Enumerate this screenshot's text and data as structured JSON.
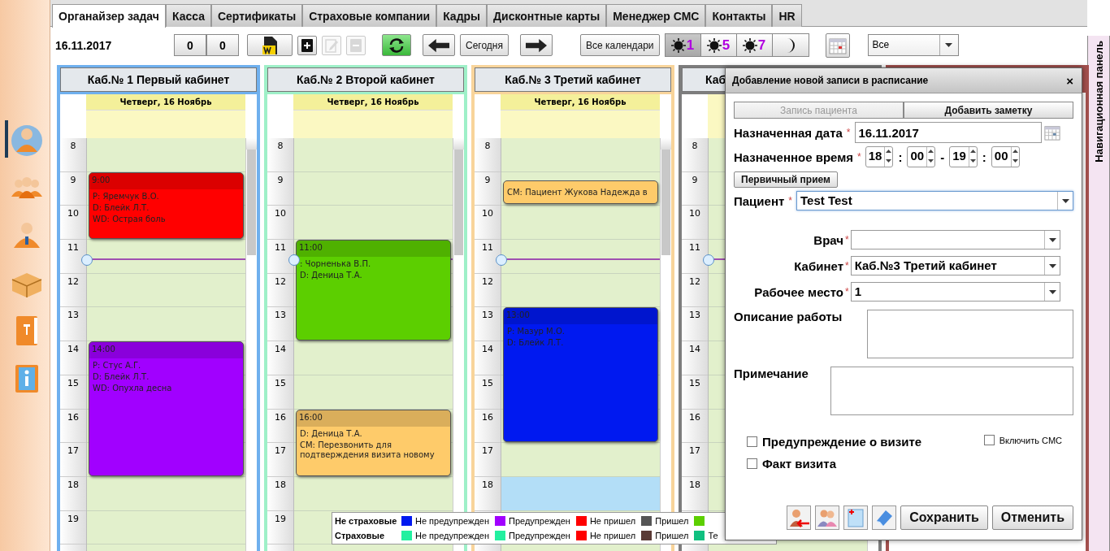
{
  "sidebar": {
    "items": [
      {
        "selected": true
      },
      {
        "selected": false
      },
      {
        "selected": false
      },
      {
        "selected": false
      },
      {
        "selected": false
      },
      {
        "selected": false
      }
    ]
  },
  "tabs": [
    {
      "label": "Органайзер задач",
      "selected": true
    },
    {
      "label": "Касса",
      "selected": false
    },
    {
      "label": "Сертификаты",
      "selected": false
    },
    {
      "label": "Страховые компании",
      "selected": false
    },
    {
      "label": "Кадры",
      "selected": false
    },
    {
      "label": "Дисконтные карты",
      "selected": false
    },
    {
      "label": "Менеджер СМС",
      "selected": false
    },
    {
      "label": "Контакты",
      "selected": false
    },
    {
      "label": "HR",
      "selected": false
    }
  ],
  "toolbar": {
    "date": "16.11.2017",
    "counters": [
      "0",
      "0"
    ],
    "actions": [
      {
        "kind": "word",
        "disabled": false
      },
      {
        "kind": "add",
        "disabled": false
      },
      {
        "kind": "edit",
        "disabled": true
      },
      {
        "kind": "remove",
        "disabled": true
      },
      {
        "kind": "refresh",
        "disabled": false
      }
    ],
    "today": "Сегодня",
    "all_calendars": "Все календари",
    "views": [
      {
        "kind": "day",
        "label": "1",
        "selected": true
      },
      {
        "kind": "day",
        "label": "5",
        "selected": false
      },
      {
        "kind": "day",
        "label": "7",
        "selected": false
      },
      {
        "kind": "night",
        "selected": false
      }
    ],
    "filter": "Все"
  },
  "columns": [
    {
      "title": "Каб.№ 1 Первый кабинет",
      "color": "#6fb0ee",
      "day": "Четверг, 16 Ноябрь",
      "blocks": [
        {
          "kind": "free",
          "hours": [
            "8"
          ]
        },
        {
          "kind": "visit",
          "hours": [
            "9",
            "10"
          ],
          "color": "#ff0000",
          "time": "9:00",
          "lines": [
            "P: Яремчук В.О.",
            "D: Блейк Л.Т.",
            "WD: Острая боль"
          ]
        },
        {
          "kind": "free",
          "hours": [
            "11",
            "12",
            "13"
          ]
        },
        {
          "kind": "visit",
          "hours": [
            "14",
            "15",
            "16",
            "17"
          ],
          "color": "#a100ff",
          "time": "14:00",
          "lines": [
            "P: Стус А.Г.",
            "D: Блейк Л.Т.",
            "WD: Опухла десна"
          ]
        },
        {
          "kind": "free",
          "hours": [
            "18",
            "19"
          ]
        }
      ]
    },
    {
      "title": "Каб.№ 2 Второй кабинет",
      "color": "#9ef0c8",
      "day": "Четверг, 16 Ноябрь",
      "blocks": [
        {
          "kind": "free",
          "hours": [
            "8",
            "9",
            "10"
          ]
        },
        {
          "kind": "visit",
          "hours": [
            "11",
            "12",
            "13"
          ],
          "color": "#5ccf00",
          "time": "11:00",
          "lines": [
            ": Чорненька В.П.",
            "D: Деница Т.А."
          ]
        },
        {
          "kind": "free",
          "hours": [
            "14",
            "15"
          ]
        },
        {
          "kind": "visit",
          "hours": [
            "16",
            "17"
          ],
          "color": "#fecb6a",
          "time": "16:00",
          "lines": [
            "D: Деница Т.А.",
            "СМ: Перезвонить для подтверждения визита новому"
          ]
        },
        {
          "kind": "free",
          "hours": [
            "18",
            "19"
          ]
        }
      ]
    },
    {
      "title": "Каб.№ 3 Третий кабинет",
      "color": "#f8d49a",
      "day": "Четверг, 16 Ноябрь",
      "blocks": [
        {
          "kind": "free",
          "hours": [
            "8"
          ]
        },
        {
          "kind": "note",
          "hours": [
            "9"
          ],
          "color": "#fecb6a",
          "lines": [
            "СМ: Пациент Жукова Надежда в"
          ]
        },
        {
          "kind": "free",
          "hours": [
            "10",
            "11",
            "12"
          ]
        },
        {
          "kind": "visit",
          "hours": [
            "13",
            "14",
            "15",
            "16"
          ],
          "color": "#0019f0",
          "time": "13:00",
          "lines": [
            "P: Мазур М.О.",
            "D: Блейк Л.Т."
          ]
        },
        {
          "kind": "free",
          "hours": [
            "17"
          ]
        },
        {
          "kind": "selection",
          "hours": [
            "18"
          ]
        }
      ]
    },
    {
      "title": "Каб",
      "color": "#7d7d7d",
      "blocks": [
        {
          "kind": "free",
          "hours": [
            "8",
            "9",
            "10",
            "11",
            "12",
            "13",
            "14",
            "15",
            "16",
            "17",
            "18"
          ]
        }
      ]
    },
    {
      "color": "#a3504e"
    }
  ],
  "legend": [
    {
      "title": "Не страховые",
      "items": [
        {
          "color": "#0019f0",
          "label": "Не предупрежден"
        },
        {
          "color": "#a100ff",
          "label": "Предупрежден"
        },
        {
          "color": "#ff0000",
          "label": "Не пришел"
        },
        {
          "color": "#555555",
          "label": "Пришел"
        },
        {
          "color": "#5ccf00"
        }
      ]
    },
    {
      "title": "Страховые",
      "items": [
        {
          "color": "#22f0a0",
          "label": "Не предупрежден"
        },
        {
          "color": "#22f0a0",
          "label": "Предупрежден"
        },
        {
          "color": "#ff0000",
          "label": "Не пришел"
        },
        {
          "color": "#5a3a35",
          "label": "Пришел"
        },
        {
          "color": "#10c080",
          "label": "Те"
        }
      ]
    }
  ],
  "nav_panel": "Навигационная панель",
  "dialog": {
    "title": "Добавление новой записи в расписание",
    "close": "×",
    "tabs": [
      {
        "label": "Запись пациента",
        "selected": true
      },
      {
        "label": "Добавить заметку",
        "selected": false
      }
    ],
    "date": {
      "label": "Назначенная дата",
      "mark": "*",
      "value": "16.11.2017"
    },
    "time": {
      "label": "Назначенное время",
      "mark": "*",
      "parts": [
        "18",
        "00",
        "19",
        "00"
      ],
      "separators": [
        ":",
        "-",
        ":"
      ]
    },
    "first_visit": "Первичный прием",
    "patient": {
      "label": "Пациент",
      "mark": "*",
      "value": "Test Test"
    },
    "selects": [
      {
        "label": "Врач",
        "mark": "*"
      },
      {
        "label": "Кабинет",
        "mark": "*",
        "value": "Каб.№3 Третий кабинет"
      },
      {
        "label": "Рабочее место",
        "mark": "*",
        "value": "1"
      }
    ],
    "description": {
      "label": "Описание работы"
    },
    "remark": {
      "label": "Примечание"
    },
    "warn": {
      "label": "Предупреждение о визите",
      "checked": false
    },
    "sms": {
      "label": "Включить СМС",
      "checked": false
    },
    "fact": {
      "label": "Факт визита",
      "checked": false
    },
    "save": "Сохранить",
    "cancel": "Отменить"
  }
}
